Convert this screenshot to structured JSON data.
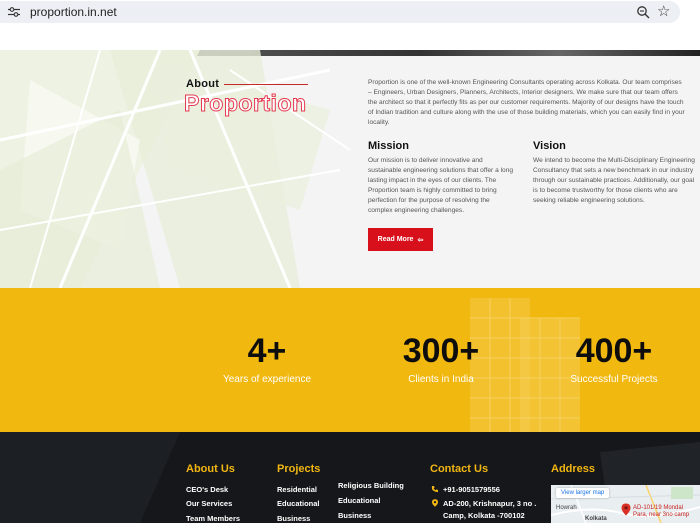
{
  "browser": {
    "url": "proportion.in.net"
  },
  "about": {
    "kicker": "About",
    "title": "Proportion",
    "description": "Proportion is one of the well-known Engineering Consultants operating across Kolkata. Our team comprises – Engineers, Urban Designers, Planners, Architects, Interior designers. We make sure that our team offers the architect so that it perfectly fits as per our customer requirements. Majority of our designs have the touch of Indian tradition and culture along with the use of those building materials, which you can easily find in your locality.",
    "mission_title": "Mission",
    "mission_text": "Our mission is to deliver innovative and sustainable engineering solutions that offer a long lasting impact in the eyes of our clients. The Proportion team is highly committed to bring perfection for the purpose of resolving the complex engineering challenges.",
    "vision_title": "Vision",
    "vision_text": "We intend to become the Multi-Disciplinary Engineering Consultancy that sets a new benchmark in our industry through our sustainable practices. Additionally, our goal is to become trustworthy for those clients who are seeking reliable engineering solutions.",
    "read_more": "Read More"
  },
  "stats": [
    {
      "value": "4+",
      "label": "Years of experience"
    },
    {
      "value": "300+",
      "label": "Clients in India"
    },
    {
      "value": "400+",
      "label": "Successful Projects"
    }
  ],
  "footer": {
    "about_us": {
      "heading": "About Us",
      "links": [
        "CEO's Desk",
        "Our Services",
        "Team Members"
      ]
    },
    "projects": {
      "heading": "Projects",
      "col1": [
        "Residential",
        "Educational",
        "Business"
      ],
      "col2": [
        "Religious Building",
        "Educational",
        "Business"
      ]
    },
    "contact": {
      "heading": "Contact Us",
      "phone": "+91-9051579556",
      "address_line1": "AD-200, Krishnapur, 3 no .",
      "address_line2": "Camp, Kolkata -700102"
    },
    "address": {
      "heading": "Address",
      "map_link": "View larger map",
      "map_place_line1": "AD-101/19 Mondal",
      "map_place_line2": "Para, near 3no camp",
      "map_labels": [
        "Howrah",
        "Kolkata"
      ]
    }
  },
  "colors": {
    "accent_red": "#d8101c",
    "stats_yellow": "#f1b810",
    "footer_heading": "#f2b613",
    "footer_bg": "#141619"
  }
}
